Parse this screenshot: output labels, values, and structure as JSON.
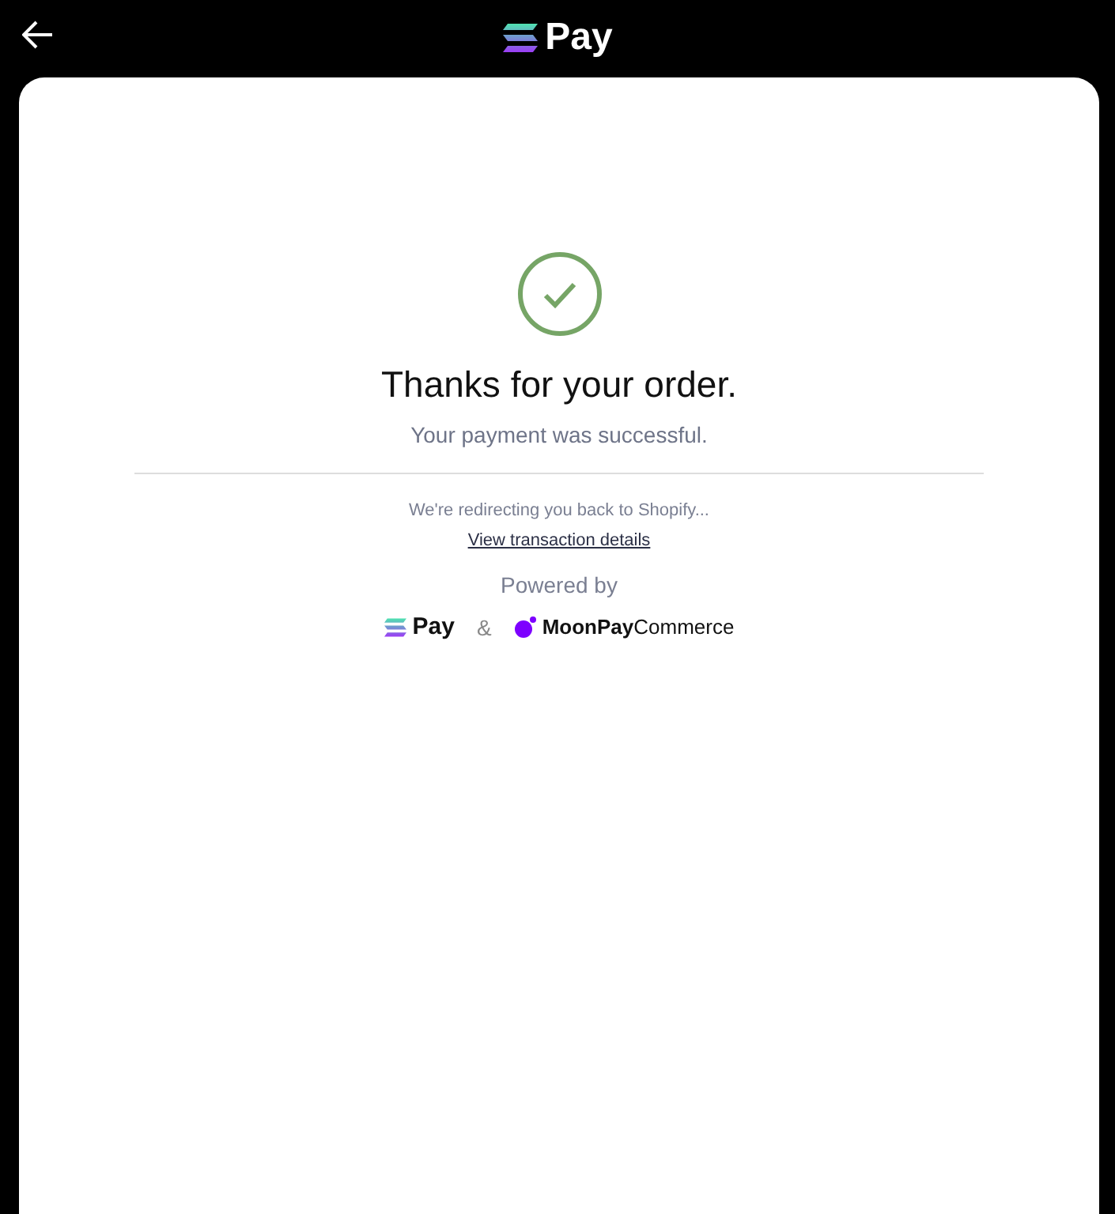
{
  "header": {
    "logo_text": "Pay"
  },
  "status": {
    "title": "Thanks for your order.",
    "subtitle": "Your payment was successful."
  },
  "redirect": {
    "message": "We're redirecting you back to Shopify...",
    "link": "View transaction details"
  },
  "powered_by": {
    "label": "Powered by",
    "logo_text": "Pay",
    "separator": "&",
    "partner": "**MoonPay**Commerce"
  }
}
